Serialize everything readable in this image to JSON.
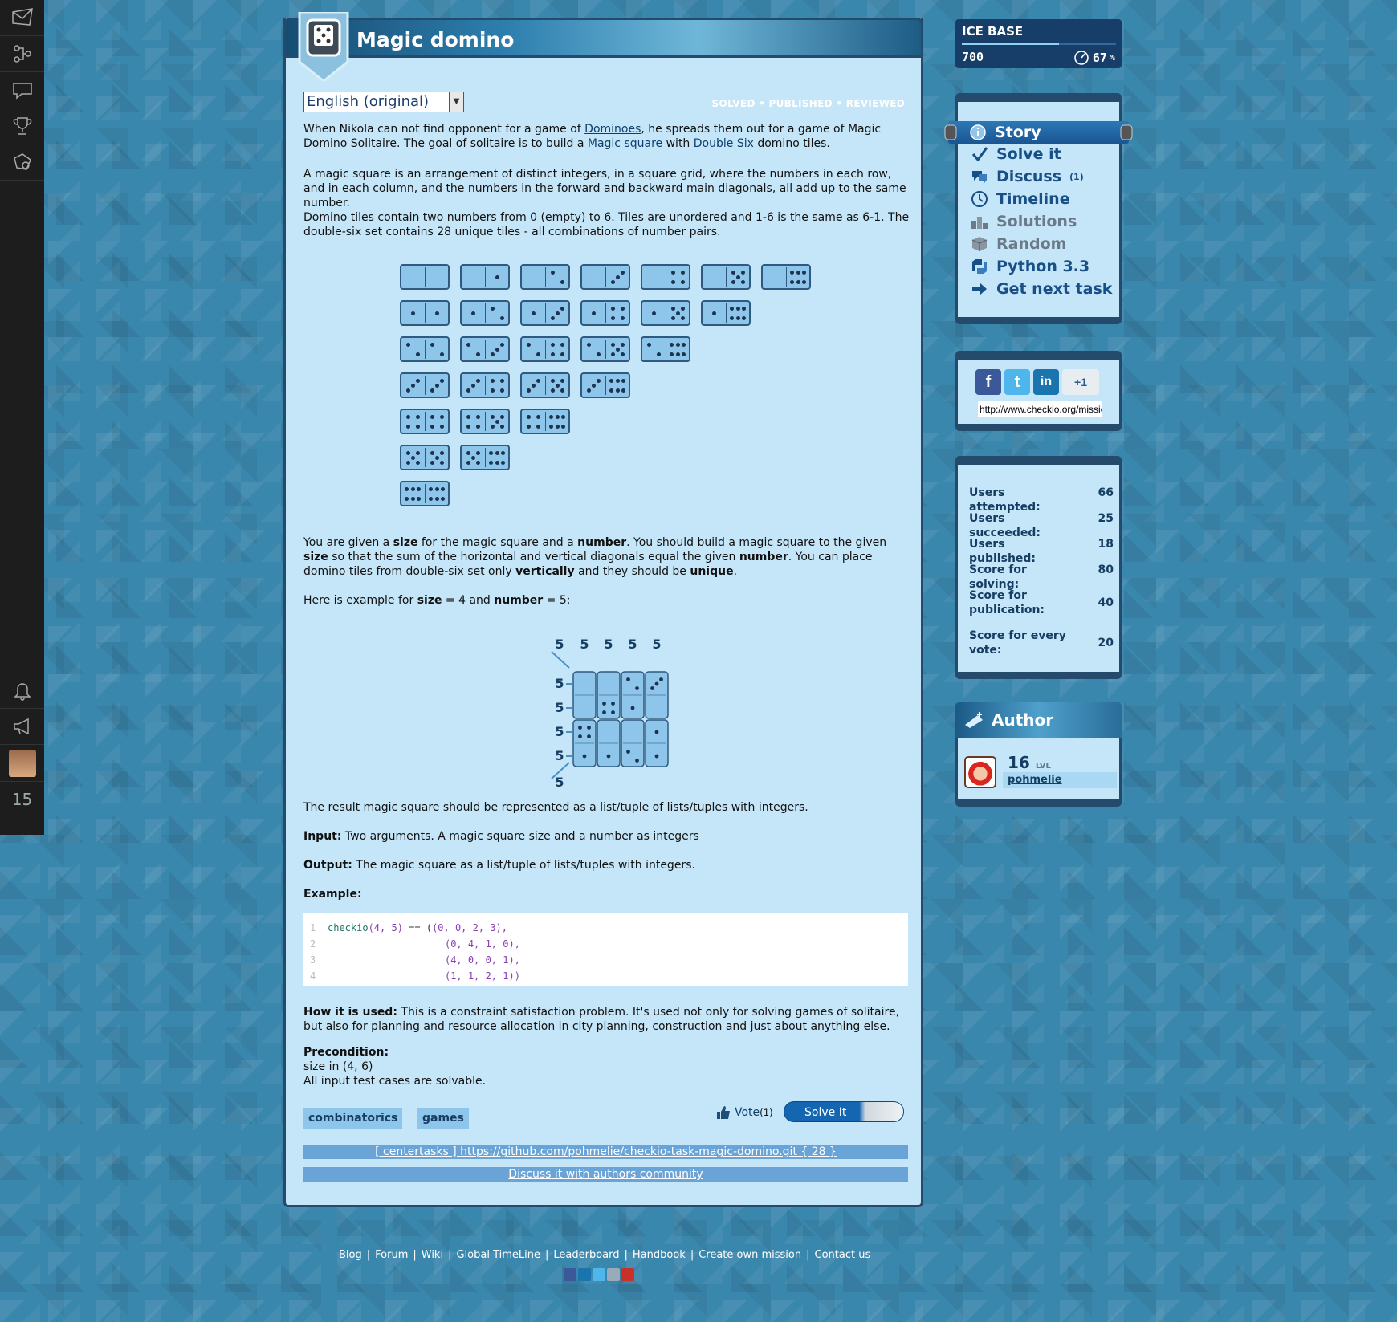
{
  "title": "Magic domino",
  "language": "English (original)",
  "status_flags": "SOLVED • PUBLISHED • REVIEWED",
  "intro": {
    "t1": "When Nikola can not find opponent for a game of ",
    "link1": "Dominoes",
    "t2": ", he spreads them out for a game of Magic Domino Solitaire. The goal of solitaire is to build a ",
    "link2": "Magic square",
    "t3": " with ",
    "link3": "Double Six",
    "t4": " domino tiles."
  },
  "p_magic_square": "A magic square is an arrangement of distinct integers, in a square grid, where the numbers in each row, and in each column, and the numbers in the forward and backward main diagonals, all add up to the same number.",
  "p_domino_tiles": "Domino tiles contain two numbers from 0 (empty) to 6. Tiles are unordered and 1-6 is the same as 6-1. The double-six set contains 28 unique tiles - all combinations of number pairs.",
  "task": {
    "t1": "You are given a ",
    "b1": "size",
    "t2": " for the magic square and a ",
    "b2": "number",
    "t3": ". You should build a magic square to the given ",
    "b3": "size",
    "t4": " so that the sum of the horizontal and vertical diagonals equal the given ",
    "b4": "number",
    "t5": ". You can place domino tiles from double-six set only ",
    "b5": "vertically",
    "t6": " and they should be ",
    "b6": "unique",
    "t7": "."
  },
  "example_line": {
    "t1": "Here is example for ",
    "b1": "size",
    "t2": " = 4 and ",
    "b2": "number",
    "t3": " = 5:"
  },
  "magic_example": {
    "sum_label": "5",
    "grid": [
      [
        0,
        0,
        2,
        3
      ],
      [
        0,
        4,
        1,
        0
      ],
      [
        4,
        0,
        0,
        1
      ],
      [
        1,
        1,
        2,
        1
      ]
    ]
  },
  "p_result": "The result magic square should be represented as a list/tuple of lists/tuples with integers.",
  "input": {
    "label": "Input:",
    "text": " Two arguments. A magic square size and a number as integers"
  },
  "output": {
    "label": "Output:",
    "text": " The magic square as a list/tuple of lists/tuples with integers."
  },
  "example_label": "Example:",
  "code": {
    "line_numbers": [
      "1",
      "2",
      "3",
      "4"
    ],
    "fn": "checkio",
    "call_args": "(4, 5)",
    "op": " == (",
    "rows": [
      "(0, 0, 2, 3),",
      "(0, 4, 1, 0),",
      "(4, 0, 0, 1),",
      "(1, 1, 2, 1))"
    ]
  },
  "how_used": {
    "label": "How it is used:",
    "text": " This is a constraint satisfaction problem. It's used not only for solving games of solitaire, but also for planning and resource allocation in city planning, construction and just about anything else."
  },
  "precondition": {
    "label": "Precondition:",
    "line1": "size in (4, 6)",
    "line2": "All input test cases are solvable."
  },
  "tags": [
    "combinatorics",
    "games"
  ],
  "vote": {
    "label": "Vote",
    "count": "(1)"
  },
  "solve_button": "Solve It",
  "repo_link": "[ centertasks ] https://github.com/pohmelie/checkio-task-magic-domino.git { 28 }",
  "discuss_link": "Discuss it with authors community",
  "ice_base": {
    "title": "ICE BASE",
    "value": "700",
    "percent": "67",
    "percent_sign": "%",
    "progress_fraction": 0.63
  },
  "menu": [
    {
      "label": "Story"
    },
    {
      "label": "Solve it"
    },
    {
      "label": "Discuss",
      "count": "(1)"
    },
    {
      "label": "Timeline"
    },
    {
      "label": "Solutions"
    },
    {
      "label": "Random"
    },
    {
      "label": "Python 3.3"
    },
    {
      "label": "Get next task"
    }
  ],
  "share_url": "http://www.checkio.org/mission/magic-domino/",
  "social": {
    "gplus": "+1"
  },
  "stats": [
    {
      "label": "Users attempted:",
      "value": "66"
    },
    {
      "label": "Users succeeded:",
      "value": "25"
    },
    {
      "label": "Users published:",
      "value": "18"
    },
    {
      "label": "Score for solving:",
      "value": "80"
    },
    {
      "label": "Score for publication:",
      "value": "40"
    },
    {
      "label": "Score for every vote:",
      "value": "20"
    }
  ],
  "author": {
    "title": "Author",
    "level": "16",
    "level_unit": "LVL",
    "name": "pohmelie"
  },
  "sidebar_level": "15",
  "footer": [
    "Blog",
    "Forum",
    "Wiki",
    "Global TimeLine",
    "Leaderboard",
    "Handbook",
    "Create own mission",
    "Contact us"
  ],
  "colors": {
    "panel_bg": "#c5e6f8",
    "header": "#1e5c85",
    "accent": "#174f86",
    "domino": "#8ec6eb"
  }
}
